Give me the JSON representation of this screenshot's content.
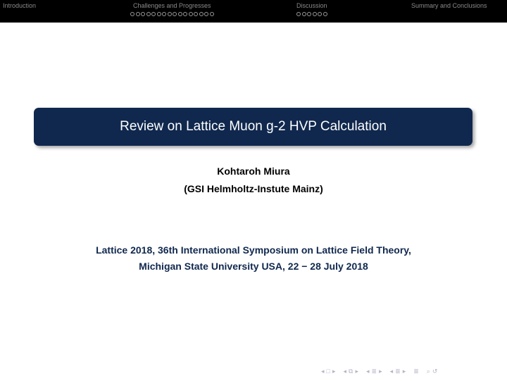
{
  "nav": {
    "sections": [
      {
        "label": "Introduction",
        "dots": 0
      },
      {
        "label": "Challenges and Progresses",
        "dots": 16
      },
      {
        "label": "Discussion",
        "dots": 6
      },
      {
        "label": "Summary and Conclusions",
        "dots": 0
      }
    ]
  },
  "title": "Review on Lattice Muon g-2 HVP Calculation",
  "author": {
    "name": "Kohtaroh Miura",
    "affiliation": "(GSI Helmholtz-Instute Mainz)"
  },
  "conference": {
    "line1": "Lattice 2018, 36th International Symposium on Lattice Field Theory,",
    "line2": "Michigan State University USA, 22 − 28 July 2018"
  },
  "colors": {
    "title_box": "#10284e",
    "nav_bar": "#000000",
    "conference_text": "#10284e"
  }
}
